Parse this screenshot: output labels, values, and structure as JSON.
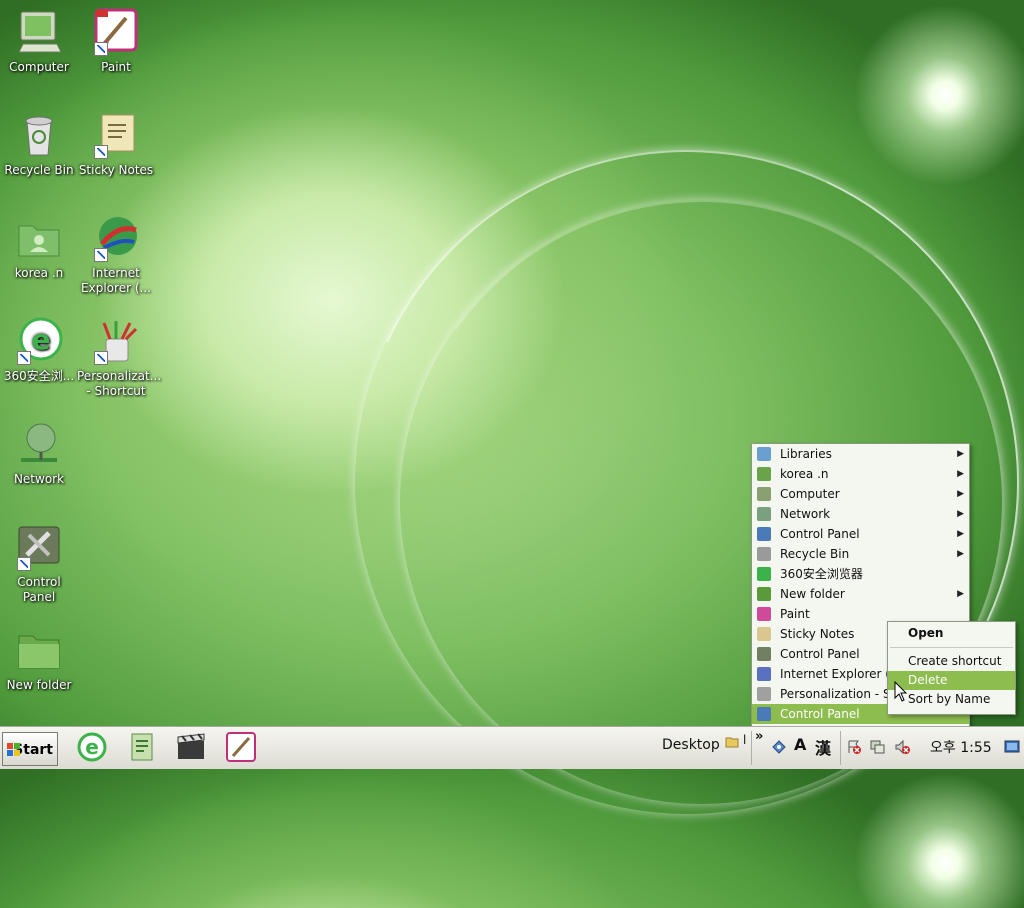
{
  "desktop": {
    "icons": [
      {
        "label": "Computer",
        "icon": "computer-icon"
      },
      {
        "label": "Paint",
        "icon": "paint-icon"
      },
      {
        "label": "Recycle Bin",
        "icon": "recycle-bin-icon"
      },
      {
        "label": "Sticky Notes",
        "icon": "sticky-notes-icon"
      },
      {
        "label": "korea .n",
        "icon": "user-folder-icon"
      },
      {
        "label": "Internet Explorer (...",
        "icon": "globe-icon"
      },
      {
        "label": "360安全浏...",
        "icon": "browser-360-icon"
      },
      {
        "label": "Personalizat... - Shortcut",
        "icon": "personalization-icon"
      },
      {
        "label": "Network",
        "icon": "network-icon"
      },
      {
        "label": "Control Panel",
        "icon": "control-panel-icon"
      },
      {
        "label": "New folder",
        "icon": "folder-icon"
      }
    ]
  },
  "toolbar_menu": {
    "items": [
      {
        "label": "Libraries",
        "submenu": true,
        "icon_color": "#6a9fd0"
      },
      {
        "label": "korea .n",
        "submenu": true,
        "icon_color": "#6aa34a"
      },
      {
        "label": "Computer",
        "submenu": true,
        "icon_color": "#8aa070"
      },
      {
        "label": "Network",
        "submenu": true,
        "icon_color": "#7aa080"
      },
      {
        "label": "Control Panel",
        "submenu": true,
        "icon_color": "#4a7ab8"
      },
      {
        "label": "Recycle Bin",
        "submenu": true,
        "icon_color": "#9a9a9a"
      },
      {
        "label": "360安全浏览器",
        "submenu": false,
        "icon_color": "#3cb24a"
      },
      {
        "label": "New folder",
        "submenu": true,
        "icon_color": "#5a9a3a"
      },
      {
        "label": "Paint",
        "submenu": false,
        "icon_color": "#d04a9a"
      },
      {
        "label": "Sticky Notes",
        "submenu": false,
        "icon_color": "#d8c890"
      },
      {
        "label": "Control Panel",
        "submenu": false,
        "icon_color": "#708060"
      },
      {
        "label": "Internet Explorer (No",
        "submenu": false,
        "icon_color": "#5a70c0"
      },
      {
        "label": "Personalization - Sho",
        "submenu": false,
        "icon_color": "#a0a0a0"
      },
      {
        "label": "Control Panel",
        "submenu": false,
        "icon_color": "#4a7ab8",
        "highlighted": true
      }
    ]
  },
  "context_menu": {
    "open": "Open",
    "create_shortcut": "Create shortcut",
    "delete": "Delete",
    "sort_by_name": "Sort by Name"
  },
  "taskbar": {
    "start_label": "Start",
    "desktop_label": "Desktop",
    "desktop_suffix": "l",
    "chevron": "»",
    "ime_a": "A",
    "ime_han": "漢",
    "clock": "오후 1:55"
  },
  "colors": {
    "menu_highlight": "#8dbd4e",
    "ie_blue": "#1f6fd0",
    "green_360": "#3cb24a"
  }
}
